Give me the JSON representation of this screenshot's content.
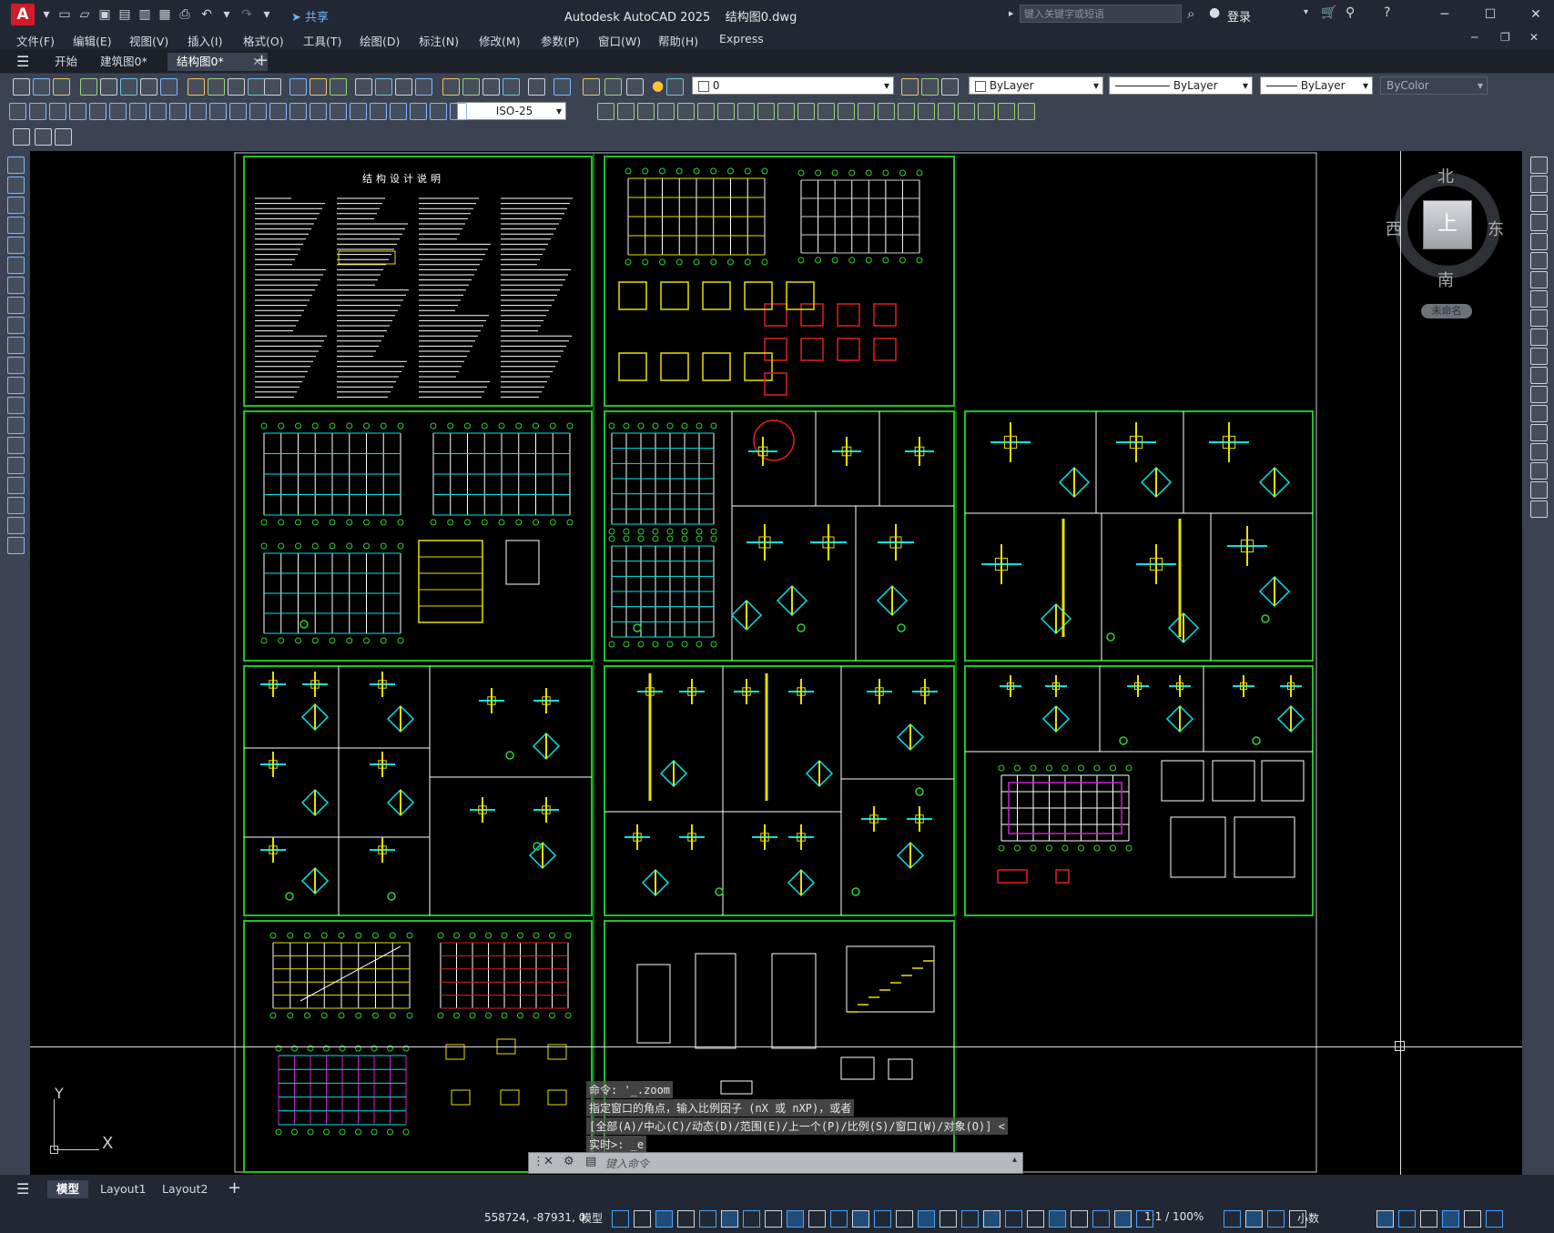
{
  "app": {
    "logo": "A",
    "title": "Autodesk AutoCAD 2025    结构图0.dwg",
    "share_label": "共享",
    "search_placeholder": "键入关键字或短语",
    "login_label": "登录"
  },
  "menus": [
    "文件(F)",
    "编辑(E)",
    "视图(V)",
    "插入(I)",
    "格式(O)",
    "工具(T)",
    "绘图(D)",
    "标注(N)",
    "修改(M)",
    "参数(P)",
    "窗口(W)",
    "帮助(H)",
    "Express"
  ],
  "doc_tabs": [
    {
      "label": "开始",
      "active": false
    },
    {
      "label": "建筑图0*",
      "active": false
    },
    {
      "label": "结构图0*",
      "active": true
    }
  ],
  "toolbar": {
    "layer_name": "0",
    "color": "ByLayer",
    "linetype": "ByLayer",
    "lineweight": "ByLayer",
    "plotstyle": "ByColor",
    "dimstyle": "ISO-25"
  },
  "viewcube": {
    "north": "北",
    "south": "南",
    "east": "东",
    "west": "西",
    "top": "上",
    "wcs": "未命名"
  },
  "drawing": {
    "sheet_title": "结构设计说明",
    "ucs_y": "Y",
    "ucs_x": "X"
  },
  "command": {
    "history": [
      "命令: '_.zoom",
      "指定窗口的角点，输入比例因子 (nX 或 nXP)，或者",
      "[全部(A)/中心(C)/动态(D)/范围(E)/上一个(P)/比例(S)/窗口(W)/对象(O)] <",
      "实时>: _e"
    ],
    "placeholder": "键入命令"
  },
  "layout_tabs": [
    {
      "label": "模型",
      "active": true
    },
    {
      "label": "Layout1",
      "active": false
    },
    {
      "label": "Layout2",
      "active": false
    }
  ],
  "status": {
    "coordinates": "558724, -87931, 0",
    "model_label": "模型",
    "scale": "1:1 / 100%",
    "units": "小数"
  },
  "colors": {
    "frame_green": "#1fc21f",
    "cyan": "#00e5e5",
    "yellow": "#e8e000",
    "red": "#e02020",
    "magenta": "#d020d0",
    "accent_blue": "#1e90ff"
  }
}
